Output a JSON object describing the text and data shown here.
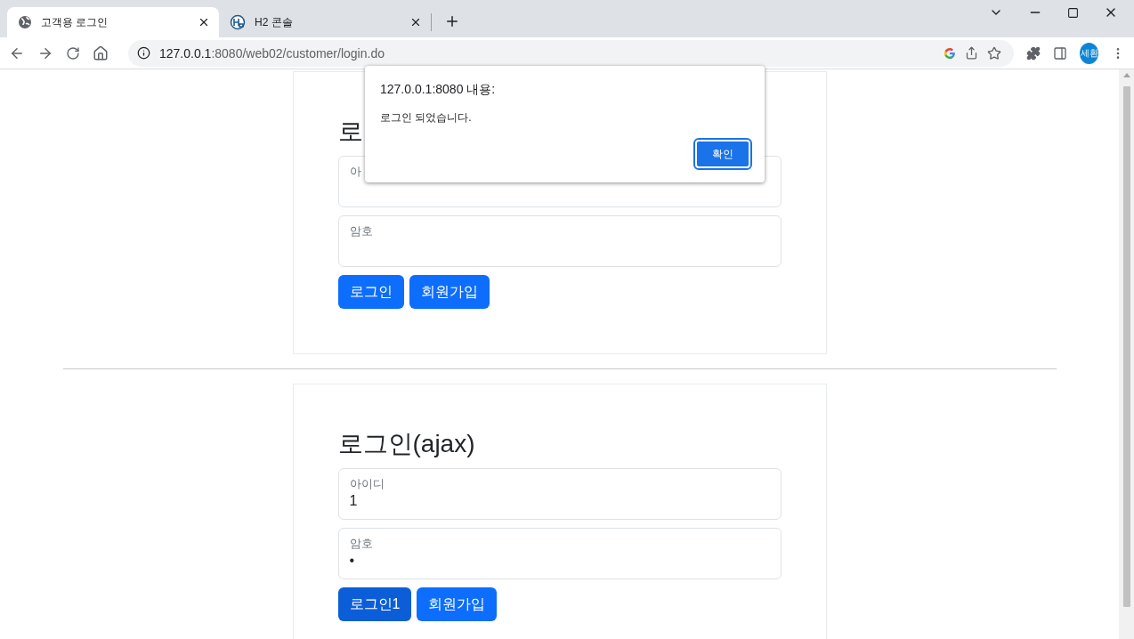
{
  "browser": {
    "tabs": [
      {
        "title": "고객용 로그인",
        "selected": true
      },
      {
        "title": "H2 콘솔",
        "selected": false
      }
    ],
    "address_host": "127.0.0.1",
    "address_path": ":8080/web02/customer/login.do",
    "profile": "세환"
  },
  "forms": [
    {
      "title": "로",
      "fields": [
        {
          "label": "아"
        },
        {
          "label": "암호"
        }
      ],
      "buttons": [
        {
          "label": "로그인",
          "pressed": false
        },
        {
          "label": "회원가입",
          "pressed": false
        }
      ]
    },
    {
      "title": "로그인(ajax)",
      "fields": [
        {
          "label": "아이디",
          "value": "1"
        },
        {
          "label": "암호",
          "value": "•"
        }
      ],
      "buttons": [
        {
          "label": "로그인1",
          "pressed": true
        },
        {
          "label": "회원가입",
          "pressed": false
        }
      ]
    }
  ],
  "dialog": {
    "title": "127.0.0.1:8080 내용:",
    "message": "로그인 되었습니다.",
    "button": "확인"
  }
}
